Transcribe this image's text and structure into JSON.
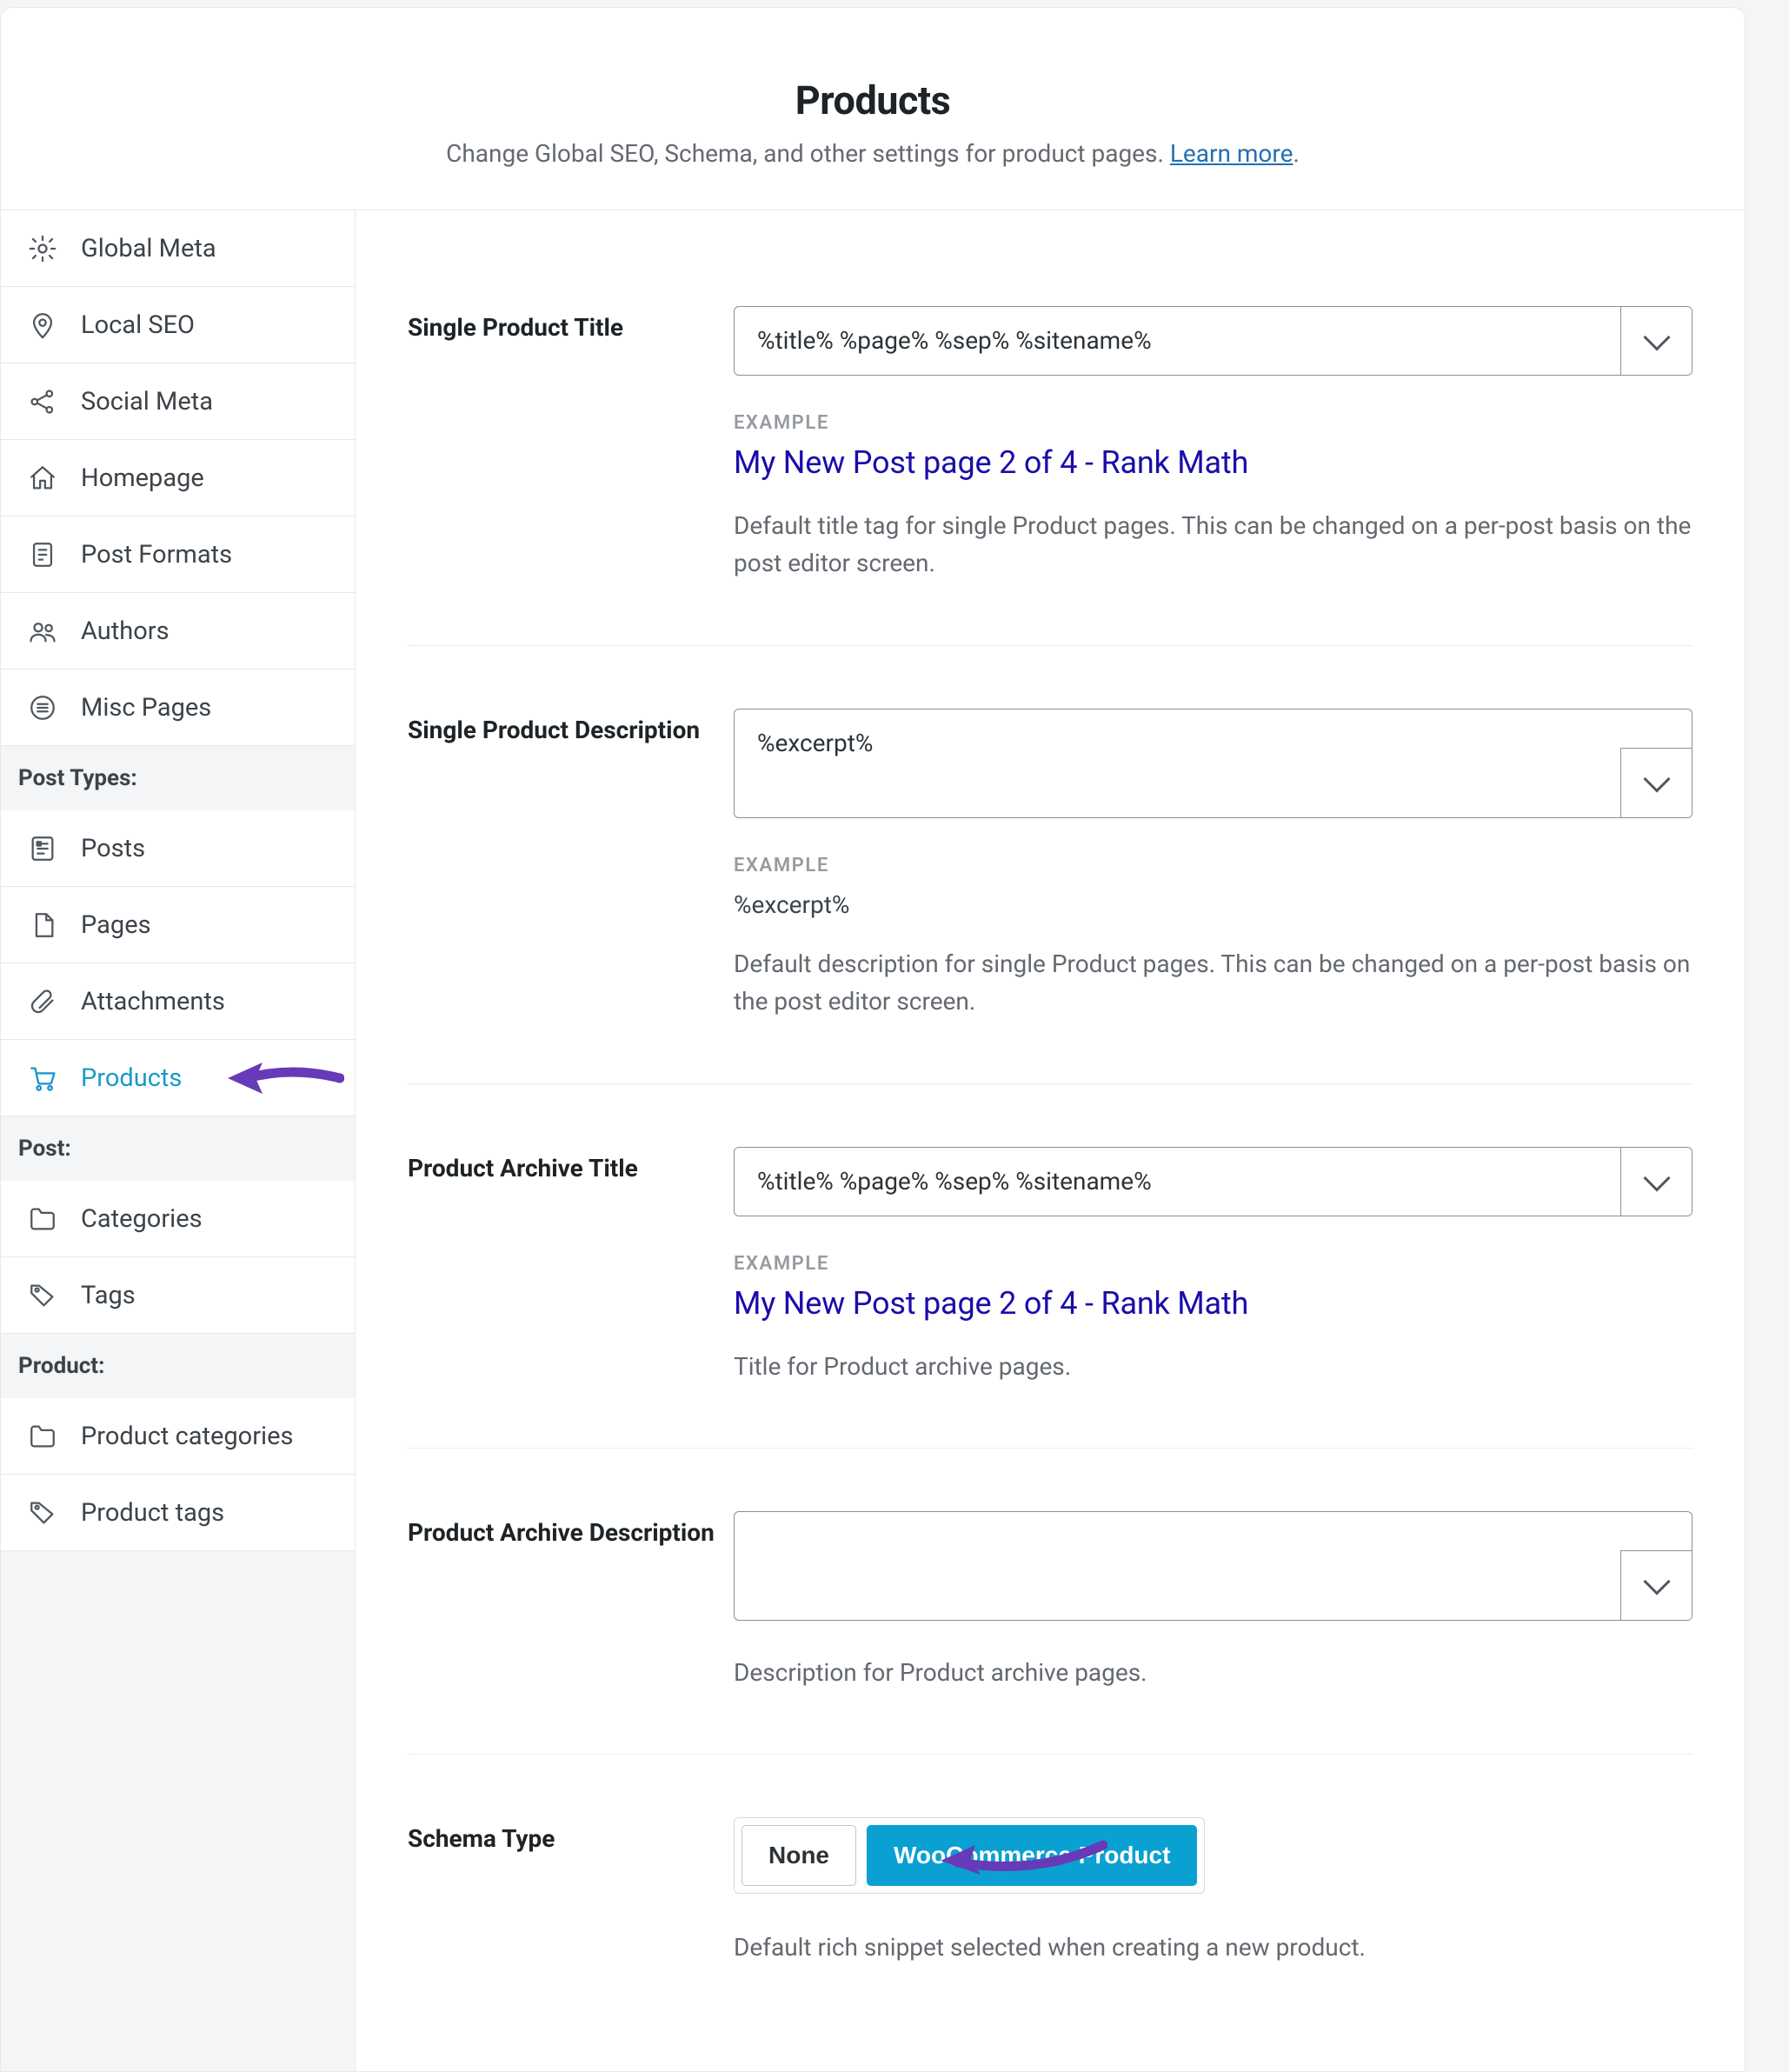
{
  "header": {
    "title": "Products",
    "subtitle_pre": "Change Global SEO, Schema, and other settings for product pages. ",
    "learn_more": "Learn more",
    "subtitle_post": "."
  },
  "sidebar": {
    "groups": [
      {
        "type": "item",
        "key": "global-meta",
        "label": "Global Meta",
        "icon": "gear-icon"
      },
      {
        "type": "item",
        "key": "local-seo",
        "label": "Local SEO",
        "icon": "pin-icon"
      },
      {
        "type": "item",
        "key": "social-meta",
        "label": "Social Meta",
        "icon": "share-icon"
      },
      {
        "type": "item",
        "key": "homepage",
        "label": "Homepage",
        "icon": "home-icon"
      },
      {
        "type": "item",
        "key": "post-formats",
        "label": "Post Formats",
        "icon": "doc-icon"
      },
      {
        "type": "item",
        "key": "authors",
        "label": "Authors",
        "icon": "users-icon"
      },
      {
        "type": "item",
        "key": "misc-pages",
        "label": "Misc Pages",
        "icon": "list-icon"
      },
      {
        "type": "section",
        "label": "Post Types:"
      },
      {
        "type": "item",
        "key": "posts",
        "label": "Posts",
        "icon": "article-icon"
      },
      {
        "type": "item",
        "key": "pages",
        "label": "Pages",
        "icon": "page-icon"
      },
      {
        "type": "item",
        "key": "attachments",
        "label": "Attachments",
        "icon": "attach-icon"
      },
      {
        "type": "item",
        "key": "products",
        "label": "Products",
        "icon": "cart-icon",
        "active": true,
        "arrow": true
      },
      {
        "type": "section",
        "label": "Post:"
      },
      {
        "type": "item",
        "key": "categories",
        "label": "Categories",
        "icon": "folder-icon"
      },
      {
        "type": "item",
        "key": "tags",
        "label": "Tags",
        "icon": "tag-icon"
      },
      {
        "type": "section",
        "label": "Product:"
      },
      {
        "type": "item",
        "key": "product-cats",
        "label": "Product categories",
        "icon": "folder-icon"
      },
      {
        "type": "item",
        "key": "product-tags",
        "label": "Product tags",
        "icon": "tag-icon"
      }
    ]
  },
  "fields": {
    "single_title": {
      "label": "Single Product Title",
      "value": "%title% %page% %sep% %sitename%",
      "example_label": "EXAMPLE",
      "preview": "My New Post page 2 of 4 - Rank Math",
      "help": "Default title tag for single Product pages. This can be changed on a per-post basis on the post editor screen."
    },
    "single_desc": {
      "label": "Single Product Description",
      "value": "%excerpt%",
      "example_label": "EXAMPLE",
      "excerpt_preview": "%excerpt%",
      "help": "Default description for single Product pages. This can be changed on a per-post basis on the post editor screen."
    },
    "archive_title": {
      "label": "Product Archive Title",
      "value": "%title% %page% %sep% %sitename%",
      "example_label": "EXAMPLE",
      "preview": "My New Post page 2 of 4 - Rank Math",
      "help": "Title for Product archive pages."
    },
    "archive_desc": {
      "label": "Product Archive Description",
      "value": "",
      "help": "Description for Product archive pages."
    },
    "schema": {
      "label": "Schema Type",
      "options": [
        "None",
        "WooCommerce Product"
      ],
      "selected": 1,
      "help": "Default rich snippet selected when creating a new product."
    }
  }
}
